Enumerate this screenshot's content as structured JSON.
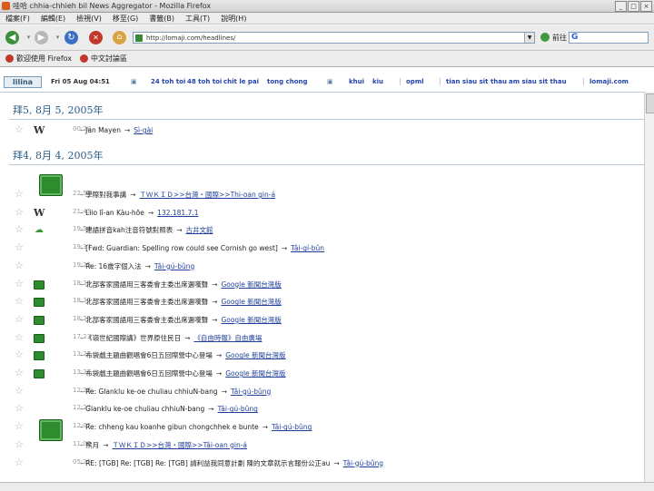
{
  "window": {
    "title": "哇哈 chhia-chhieh bil News Aggregator - Mozilla Firefox"
  },
  "menu": [
    "檔案(F)",
    "編輯(E)",
    "檢視(V)",
    "移至(G)",
    "書籤(B)",
    "工具(T)",
    "說明(H)"
  ],
  "address": {
    "url": "http://lomaji.com/headlines/",
    "go_label": "前往",
    "search_glyph": "G"
  },
  "bookmarks": [
    "歡迎使用 Firefox",
    "中文討論區"
  ],
  "header": {
    "logo": "lilina",
    "datetime": "Fri 05 Aug 04:51",
    "links": [
      "24 toh toi",
      "48 toh toi",
      "chit le pai",
      "tong chong",
      "khui",
      "kiu",
      "opml",
      "tian siau sit thau",
      "am siau sit thau",
      "lomaji.com"
    ]
  },
  "sections": [
    {
      "date": "拜5, 8月 5, 2005年",
      "items": [
        {
          "icon": "wikipedia-icon",
          "time": "00:20",
          "title": "Jan Mayen",
          "source": "Sì-gài"
        }
      ]
    },
    {
      "date": "拜4, 8月 4, 2005年",
      "items": [
        {
          "icon": "avatar-icon",
          "time": "22:52",
          "title": "學際對我事講",
          "source": "ＴＷＫＩＤ>>台灣・國際>>Thi-oan gin-á"
        },
        {
          "icon": "wikipedia-icon",
          "time": "21:45",
          "title": "Liio lî-an Kàu-hōe",
          "source": "132.181.7.1"
        },
        {
          "icon": "cloud-icon",
          "time": "19:54",
          "title": "建語拼音kah注音符號對照表",
          "source": "古井文館"
        },
        {
          "icon": "none",
          "time": "19:37",
          "title": "[Fwd: Guardian: Spelling row could see Cornish go west]",
          "source": "Tâi-gí-bûn"
        },
        {
          "icon": "none",
          "time": "19:25",
          "title": "Re: 16歲字個入法",
          "source": "Tâi-gú-bûng"
        },
        {
          "icon": "computer-icon",
          "time": "18:29",
          "title": "北部客家國語用三客委會主委出席選嘆聲",
          "source": "Google 新聞台灣版"
        },
        {
          "icon": "computer-icon",
          "time": "18:27",
          "title": "北部客家國語用三客委會主委出席選嘆聲",
          "source": "Google 新聞台灣版"
        },
        {
          "icon": "computer-icon",
          "time": "18:25",
          "title": "北部客家國語用三客委會主委出席選嘆聲",
          "source": "Google 新聞台灣版"
        },
        {
          "icon": "computer-icon",
          "time": "17:23",
          "title": "《嶺世紀國際講》世界原住民日",
          "source": "《自由時報》自由廣場"
        },
        {
          "icon": "computer-icon",
          "time": "13:27",
          "title": "布袋戲主題曲觀唱會6日五回際營中心登場",
          "source": "Google 新聞台灣版"
        },
        {
          "icon": "computer-icon",
          "time": "13:27",
          "title": "布袋戲主題曲觀唱會6日五回際營中心登場",
          "source": "Google 新聞台灣版"
        },
        {
          "icon": "none",
          "time": "12:28",
          "title": "Re: Glanklu ke-oe chuliau chhiuN-bang",
          "source": "Tâi-gú-bûng"
        },
        {
          "icon": "none",
          "time": "12:27",
          "title": "Glanklu ke-oe chuliau chhiuN-bang",
          "source": "Tâi-gú-bûng"
        },
        {
          "icon": "none",
          "time": "12:07",
          "title": "Re: chheng kau koanhe gibun chongchhek e bunte",
          "source": "Tâi-gú-bûng"
        },
        {
          "icon": "avatar-icon",
          "time": "11:00",
          "title": "熊月",
          "source": "ＴＷＫＩＤ>>台灣・國際>>Tâi-oan gin-á"
        },
        {
          "icon": "none",
          "time": "05:25",
          "title": "RE: [TGB] Re: [TGB] Re: [TGB] 請利益我同意計劃 陳的文章就示言報份公正au",
          "source": "Tâi-gú-bûng"
        }
      ]
    }
  ]
}
